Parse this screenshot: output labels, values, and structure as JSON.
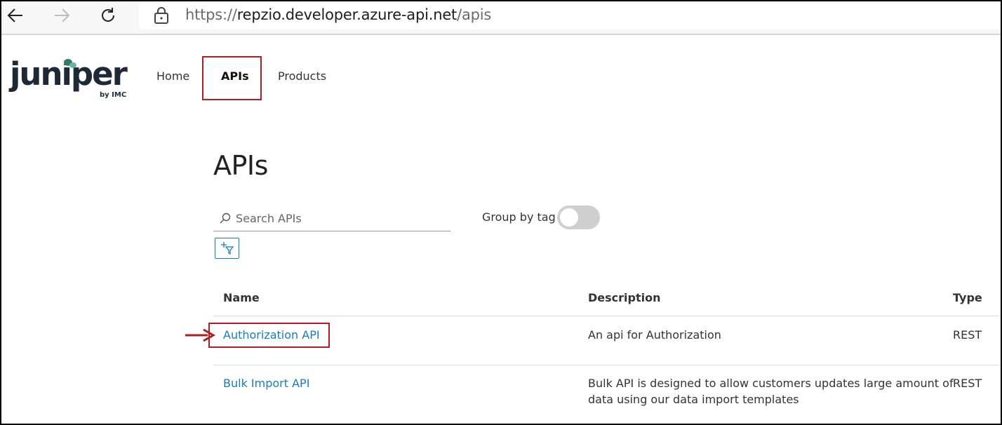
{
  "browser": {
    "url_scheme": "https://",
    "url_host": "repzio.developer.azure-api.net",
    "url_path": "/apis"
  },
  "header": {
    "logo_text": "juniper",
    "logo_sub": "by IMC",
    "nav": [
      {
        "label": "Home"
      },
      {
        "label": "APIs"
      },
      {
        "label": "Products"
      }
    ]
  },
  "main": {
    "title": "APIs",
    "search_placeholder": "Search APIs",
    "group_by_tag_label": "Group by tag",
    "group_by_tag_on": false,
    "table": {
      "columns": [
        "Name",
        "Description",
        "Type"
      ],
      "rows": [
        {
          "name": "Authorization API",
          "description": "An api for Authorization",
          "type": "REST"
        },
        {
          "name": "Bulk Import API",
          "description_line1": "Bulk API is designed to allow customers updates large amount of",
          "description_line2": "data using our data import templates",
          "type": "REST"
        }
      ]
    }
  },
  "colors": {
    "link": "#1a7bbf",
    "annotation_red": "#b01e23",
    "logo_dark": "#1d2a36",
    "logo_teal": "#2e7d6b"
  }
}
